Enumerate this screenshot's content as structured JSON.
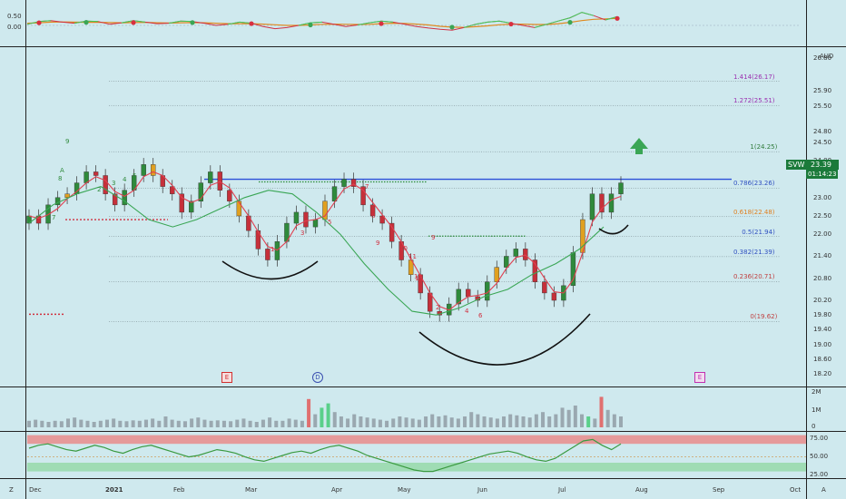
{
  "symbol": "SVW",
  "currency": "AUD",
  "price_tag": {
    "price": "23.39",
    "countdown": "01:14:23",
    "color": "#1b7a3a"
  },
  "colors": {
    "bg": "#cfe9ee",
    "bull": "#2f8a3b",
    "bear": "#c6303a",
    "neutral": "#e0a020",
    "resistance": "#2a4fd8",
    "arrow": "#3aa655",
    "fast_ma": "#e04050",
    "slow_ma": "#3aa655"
  },
  "x_axis": {
    "labels": [
      "Dec",
      "2021",
      "Feb",
      "Mar",
      "Apr",
      "May",
      "Jun",
      "Jul",
      "Aug",
      "Sep",
      "Oct"
    ],
    "left_marker": "Z",
    "right_marker": "A"
  },
  "events": [
    {
      "label": "E",
      "color": "#d03030"
    },
    {
      "label": "D",
      "color": "#3a4fb0"
    },
    {
      "label": "E",
      "color": "#c030b0"
    }
  ],
  "chart_data": [
    {
      "type": "line",
      "name": "oscillator",
      "y_ticks": [
        "0.50",
        "0.00"
      ],
      "series": [
        {
          "values": [
            0.05,
            0.18,
            0.22,
            0.15,
            0.1,
            0.2,
            0.18,
            0.05,
            0.12,
            0.22,
            0.15,
            0.08,
            0.1,
            0.2,
            0.18,
            0.1,
            0.0,
            0.05,
            0.15,
            0.1,
            -0.05,
            -0.15,
            -0.1,
            0.0,
            0.12,
            0.15,
            0.05,
            -0.05,
            0.02,
            0.12,
            0.2,
            0.15,
            0.05,
            -0.05,
            -0.12,
            -0.18,
            -0.22,
            -0.1,
            0.05,
            0.15,
            0.2,
            0.1,
            0.0,
            -0.1,
            0.05,
            0.2,
            0.35,
            0.6,
            0.45,
            0.25,
            0.4
          ]
        },
        {
          "values": [
            0.1,
            0.12,
            0.15,
            0.16,
            0.15,
            0.14,
            0.14,
            0.13,
            0.12,
            0.13,
            0.14,
            0.12,
            0.11,
            0.12,
            0.13,
            0.12,
            0.1,
            0.08,
            0.08,
            0.08,
            0.06,
            0.03,
            0.0,
            0.0,
            0.02,
            0.05,
            0.06,
            0.05,
            0.04,
            0.05,
            0.08,
            0.1,
            0.09,
            0.06,
            0.02,
            -0.04,
            -0.08,
            -0.09,
            -0.06,
            -0.02,
            0.03,
            0.06,
            0.06,
            0.04,
            0.04,
            0.08,
            0.14,
            0.22,
            0.28,
            0.3,
            0.32
          ]
        }
      ]
    },
    {
      "type": "candlestick",
      "name": "price",
      "unit": "AUD",
      "y_ticks": [
        "26.80",
        "25.90",
        "25.50",
        "24.80",
        "24.50",
        "24.00",
        "23.60",
        "23.00",
        "22.50",
        "22.00",
        "21.40",
        "20.80",
        "20.20",
        "19.80",
        "19.40",
        "19.00",
        "18.60",
        "18.20"
      ],
      "ylim": [
        18.0,
        27.0
      ],
      "fib_levels": [
        {
          "ratio": "1.414",
          "value": "26.17",
          "color": "#9b30b0"
        },
        {
          "ratio": "1.272",
          "value": "25.51",
          "color": "#9b30b0"
        },
        {
          "ratio": "1",
          "value": "24.25",
          "color": "#2f7a3a"
        },
        {
          "ratio": "0.786",
          "value": "23.26",
          "color": "#3050c0"
        },
        {
          "ratio": "0.618",
          "value": "22.48",
          "color": "#e08020"
        },
        {
          "ratio": "0.5",
          "value": "21.94",
          "color": "#3050c0"
        },
        {
          "ratio": "0.382",
          "value": "21.39",
          "color": "#3050c0"
        },
        {
          "ratio": "0.236",
          "value": "20.71",
          "color": "#c04040"
        },
        {
          "ratio": "0",
          "value": "19.62",
          "color": "#c04040"
        }
      ],
      "resistance": 23.5,
      "closes": [
        22.5,
        22.3,
        22.8,
        23.0,
        23.1,
        23.4,
        23.7,
        23.6,
        23.1,
        22.8,
        23.2,
        23.6,
        23.9,
        23.6,
        23.3,
        23.1,
        22.6,
        22.9,
        23.4,
        23.7,
        23.2,
        22.9,
        22.5,
        22.1,
        21.6,
        21.3,
        21.8,
        22.3,
        22.6,
        22.2,
        22.4,
        22.9,
        23.3,
        23.5,
        23.3,
        22.8,
        22.5,
        22.3,
        21.8,
        21.3,
        20.9,
        20.4,
        19.9,
        19.8,
        20.1,
        20.5,
        20.3,
        20.2,
        20.7,
        21.1,
        21.4,
        21.6,
        21.3,
        20.7,
        20.4,
        20.2,
        20.6,
        21.5,
        22.4,
        23.1,
        22.6,
        23.1,
        23.4
      ],
      "vwap_points": [
        22.3,
        22.8,
        23.1,
        23.3,
        22.9,
        22.4,
        22.2,
        22.4,
        22.7,
        23.0,
        23.2,
        23.1,
        22.6,
        22.0,
        21.2,
        20.5,
        19.9,
        19.8,
        20.0,
        20.3,
        20.5,
        20.9,
        21.2,
        21.6,
        22.2
      ],
      "sequence_counts_red": [
        "1",
        "2",
        "3",
        "4",
        "5",
        "6",
        "7",
        "8",
        "9",
        "9",
        "10",
        "11",
        "12",
        "13",
        "1",
        "2",
        "3",
        "4",
        "5",
        "6",
        "7",
        "8",
        "9",
        "10",
        "11",
        "12"
      ],
      "sequence_counts_green": [
        "9",
        "8",
        "7",
        "2",
        "3",
        "4",
        "5",
        "A"
      ]
    },
    {
      "type": "bar",
      "name": "volume",
      "y_ticks": [
        "2M",
        "1M",
        "0"
      ],
      "values": [
        0.3,
        0.35,
        0.3,
        0.25,
        0.3,
        0.28,
        0.4,
        0.45,
        0.35,
        0.3,
        0.25,
        0.3,
        0.35,
        0.4,
        0.3,
        0.28,
        0.32,
        0.3,
        0.35,
        0.4,
        0.3,
        0.5,
        0.35,
        0.3,
        0.28,
        0.4,
        0.45,
        0.35,
        0.3,
        0.32,
        0.3,
        0.28,
        0.35,
        0.4,
        0.3,
        0.25,
        0.35,
        0.45,
        0.3,
        0.3,
        0.4,
        0.35,
        0.3,
        1.3,
        0.6,
        0.9,
        1.1,
        0.7,
        0.5,
        0.4,
        0.6,
        0.5,
        0.45,
        0.4,
        0.35,
        0.3,
        0.4,
        0.5,
        0.45,
        0.4,
        0.35,
        0.5,
        0.6,
        0.5,
        0.55,
        0.45,
        0.4,
        0.5,
        0.7,
        0.6,
        0.5,
        0.45,
        0.4,
        0.5,
        0.6,
        0.55,
        0.5,
        0.45,
        0.6,
        0.7,
        0.5,
        0.6,
        0.9,
        0.8,
        1.0,
        0.6,
        0.5,
        0.4,
        1.4,
        0.8,
        0.6,
        0.5
      ]
    },
    {
      "type": "line",
      "name": "rsi",
      "y_ticks": [
        "75.00",
        "50.00",
        "25.00"
      ],
      "ylim": [
        20,
        85
      ],
      "values": [
        62,
        66,
        68,
        64,
        60,
        58,
        62,
        66,
        63,
        58,
        55,
        60,
        64,
        66,
        62,
        58,
        54,
        50,
        52,
        56,
        60,
        58,
        55,
        50,
        46,
        44,
        48,
        52,
        56,
        58,
        55,
        60,
        64,
        66,
        62,
        58,
        52,
        48,
        44,
        40,
        36,
        32,
        30,
        30,
        34,
        38,
        42,
        46,
        50,
        54,
        56,
        58,
        55,
        50,
        46,
        44,
        48,
        56,
        64,
        72,
        74,
        66,
        60,
        68
      ]
    }
  ]
}
